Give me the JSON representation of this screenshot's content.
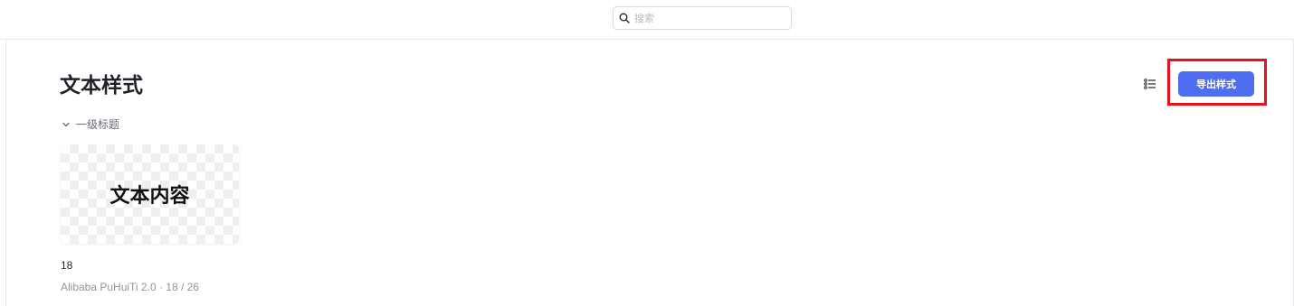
{
  "search": {
    "placeholder": "搜索",
    "icon": "search-icon"
  },
  "page": {
    "title": "文本样式"
  },
  "toolbar": {
    "view_toggle_icon": "list-view-icon",
    "export_label": "导出样式",
    "export_color": "#4e6ef2",
    "highlight_color": "#e8131a"
  },
  "section": {
    "label": "一级标题",
    "icon": "chevron-down-icon",
    "cards": [
      {
        "preview_text": "文本内容",
        "size": "18",
        "meta": "Alibaba PuHuiTi 2.0 · 18 / 26"
      }
    ]
  }
}
